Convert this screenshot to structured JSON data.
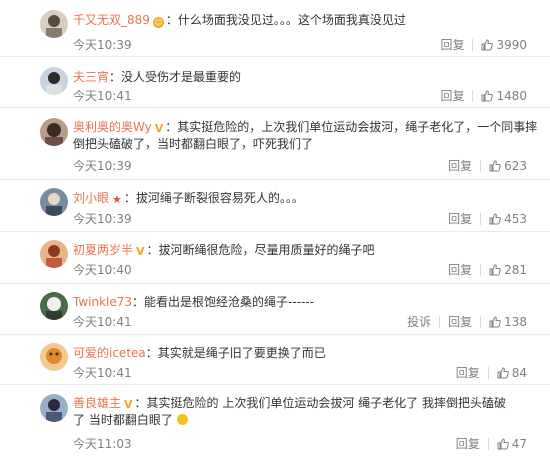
{
  "colors": {
    "username": "#eb7350",
    "meta": "#808080",
    "divider": "#ebebeb"
  },
  "icons": {
    "like": "thumb-up-icon",
    "verified": "v-badge-icon",
    "emoji": "face-emoji-icon",
    "star": "star-badge-icon"
  },
  "reply_label": "回复",
  "report_label": "投诉",
  "comments": [
    {
      "user": "千又无双_889",
      "text": "：什么场面我没见过。。。这个场面我真没见过",
      "time": "今天10:39",
      "likes": "3990"
    },
    {
      "user": "夫三宵",
      "text": "：没人受伤才是最重要的",
      "time": "今天10:41",
      "likes": "1480"
    },
    {
      "user": "奥利奥的奥Wy",
      "text": "：其实挺危险的，上次我们单位运动会拔河，绳子老化了，一个同事摔倒把头磕破了，当时都翻白眼了，吓死我们了",
      "time": "今天10:39",
      "likes": "623"
    },
    {
      "user": "刘小眼",
      "text": "：拔河绳子断裂很容易死人的。。。",
      "time": "今天10:39",
      "likes": "453"
    },
    {
      "user": "初夏两岁半",
      "text": "：拔河断绳很危险，尽量用质量好的绳子吧",
      "time": "今天10:40",
      "likes": "281"
    },
    {
      "user": "Twinkle73",
      "text": "：能看出是根饱经沧桑的绳子------",
      "time": "今天10:41",
      "likes": "138"
    },
    {
      "user": "可爱的icetea",
      "text": "：其实就是绳子旧了要更换了而已",
      "time": "今天10:41",
      "likes": "84"
    },
    {
      "user": "善良雄主",
      "text": "：其实挺危险的 上次我们单位运动会拔河 绳子老化了 我摔倒把头磕破了 当时都翻白眼了",
      "time": "今天11:03",
      "likes": "47"
    }
  ]
}
